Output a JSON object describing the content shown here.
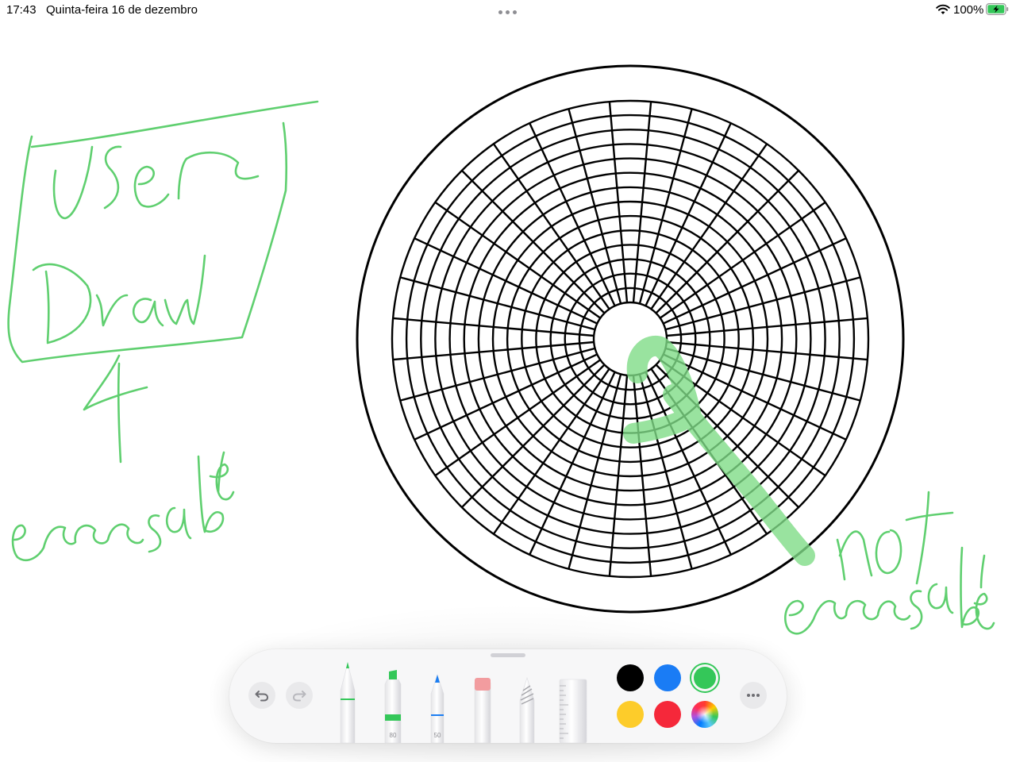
{
  "status_bar": {
    "time": "17:43",
    "date": "Quinta-feira 16 de dezembro",
    "battery": "100%",
    "icons": [
      "wifi-icon",
      "battery-charging-icon",
      "multitask-dots-icon"
    ]
  },
  "toolbar": {
    "undo_icon": "undo-arrow-icon",
    "redo_icon": "redo-arrow-icon",
    "tools": [
      {
        "name": "pen",
        "icon": "pen-tool-icon",
        "color": "#34c759"
      },
      {
        "name": "marker",
        "icon": "marker-tool-icon",
        "color": "#34c759",
        "width_label": "80"
      },
      {
        "name": "pencil",
        "icon": "pencil-tool-icon",
        "color": "#1c7ef2",
        "width_label": "50"
      },
      {
        "name": "eraser",
        "icon": "eraser-tool-icon"
      },
      {
        "name": "lasso",
        "icon": "lasso-tool-icon"
      },
      {
        "name": "ruler",
        "icon": "ruler-tool-icon"
      }
    ],
    "colors": [
      {
        "name": "black",
        "hex": "#000000"
      },
      {
        "name": "blue",
        "hex": "#1a7cf5"
      },
      {
        "name": "green",
        "hex": "#34c759",
        "selected": true
      },
      {
        "name": "yellow",
        "hex": "#fdcc2a"
      },
      {
        "name": "red",
        "hex": "#f5283a"
      },
      {
        "name": "color-picker",
        "icon": "color-wheel-icon"
      }
    ],
    "more_icon": "ellipsis-icon"
  },
  "drawing": {
    "handwritten_left": [
      "User",
      "Draw",
      "eraasable"
    ],
    "handwritten_right": [
      "not",
      "eraasable"
    ],
    "ink_color": "#5fcf6f",
    "marker_color": "#7fdc87",
    "template": "concentric circular grid",
    "grid_rings": 15,
    "grid_spokes": 36
  }
}
